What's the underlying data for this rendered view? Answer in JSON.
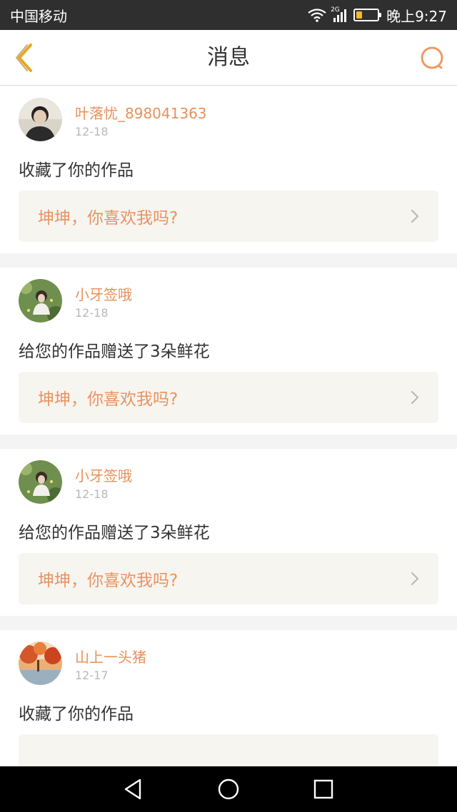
{
  "status_bar": {
    "carrier": "中国移动",
    "network": "2G",
    "battery_level": 0.3,
    "time": "晚上9:27"
  },
  "header": {
    "title": "消息",
    "back_icon": "chevron-left-icon",
    "search_icon": "search-icon"
  },
  "colors": {
    "accent": "#e8905a",
    "back_icon": "#e9a820",
    "card_link_bg": "#f6f5f0"
  },
  "messages": [
    {
      "user": "叶落忧_898041363",
      "date": "12-18",
      "action": "收藏了你的作品",
      "work": "坤坤，你喜欢我吗?"
    },
    {
      "user": "小牙签哦",
      "date": "12-18",
      "action": "给您的作品赠送了3朵鲜花",
      "work": "坤坤，你喜欢我吗?"
    },
    {
      "user": "小牙签哦",
      "date": "12-18",
      "action": "给您的作品赠送了3朵鲜花",
      "work": "坤坤，你喜欢我吗?"
    },
    {
      "user": "山上一头猪",
      "date": "12-17",
      "action": "收藏了你的作品",
      "work": ""
    }
  ],
  "system_nav": {
    "back_icon": "triangle-back-icon",
    "home_icon": "circle-home-icon",
    "recents_icon": "square-recents-icon"
  }
}
